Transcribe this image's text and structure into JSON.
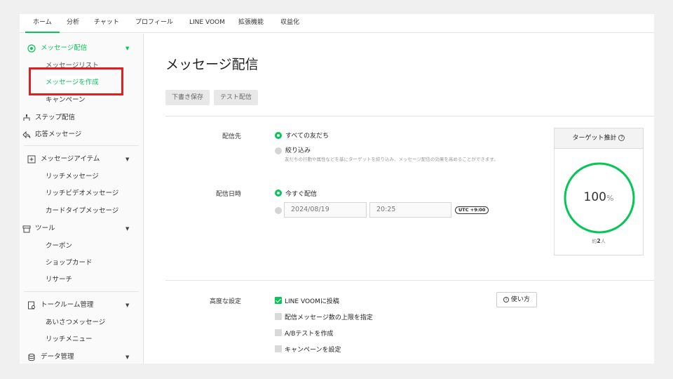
{
  "topnav": {
    "tabs": [
      "ホーム",
      "分析",
      "チャット",
      "プロフィール",
      "LINE VOOM",
      "拡張機能",
      "収益化"
    ]
  },
  "sidebar": {
    "message_delivery": "メッセージ配信",
    "message_list": "メッセージリスト",
    "create_message": "メッセージを作成",
    "campaign": "キャンペーン",
    "step_delivery": "ステップ配信",
    "auto_response": "応答メッセージ",
    "message_items": "メッセージアイテム",
    "rich_message": "リッチメッセージ",
    "rich_video": "リッチビデオメッセージ",
    "card_type": "カードタイプメッセージ",
    "tools": "ツール",
    "coupon": "クーポン",
    "shop_card": "ショップカード",
    "research": "リサーチ",
    "talkroom": "トークルーム管理",
    "greeting": "あいさつメッセージ",
    "rich_menu": "リッチメニュー",
    "data": "データ管理"
  },
  "main": {
    "title": "メッセージ配信",
    "save_draft": "下書き保存",
    "test_send": "テスト配信",
    "recipients_label": "配信先",
    "opt_all_friends": "すべての友だち",
    "opt_filter": "絞り込み",
    "filter_note": "友だちの行動や属性などを基にターゲットを絞り込み、メッセージ配信の効果を高めることができます。",
    "datetime_label": "配信日時",
    "opt_now": "今すぐ配信",
    "date_value": "2024/08/19",
    "time_value": "20:25",
    "timezone": "UTC +9:00",
    "advanced_label": "高度な設定",
    "chk_voom": "LINE VOOMに投稿",
    "chk_limit": "配信メッセージ数の上限を指定",
    "chk_ab": "A/Bテストを作成",
    "chk_campaign": "キャンペーンを設定",
    "howto": "使い方"
  },
  "target": {
    "title": "ターゲット推計",
    "percent": "100",
    "percent_unit": "%",
    "approx_prefix": "約",
    "approx_count": "2",
    "approx_unit": "人",
    "fill_fraction": 1.0
  },
  "colors": {
    "accent": "#06c755",
    "highlight_box": "#e02020"
  }
}
